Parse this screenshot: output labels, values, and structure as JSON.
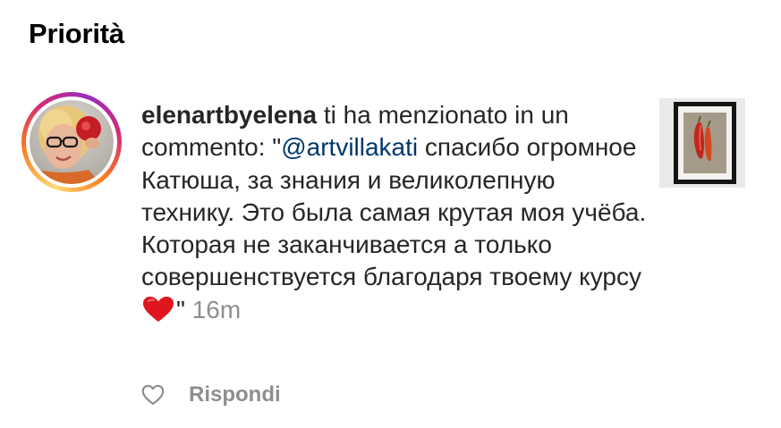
{
  "section": {
    "title": "Priorità"
  },
  "notification": {
    "username": "elenartbyelena",
    "action_text": " ti ha menzionato in un commento: \"",
    "mention": "@artvillakati",
    "comment_text": " спасибо огромное Катюша, за знания и великолепную технику. Это была самая крутая моя учёба. Которая не заканчивается а только совершенствуется благодаря твоему курсу",
    "emoji": "red-heart",
    "closing_quote": "\"",
    "timestamp": "16m",
    "avatar_icon": "user-avatar",
    "thumbnail_icon": "post-thumbnail-framed-peppers",
    "story_ring_colors": [
      "#feda75",
      "#fa7e1e",
      "#d62976",
      "#962fbf"
    ]
  },
  "actions": {
    "like_icon": "heart-outline-icon",
    "reply_label": "Rispondi"
  },
  "colors": {
    "text": "#262626",
    "mention": "#00376b",
    "muted": "#8e8e8e",
    "heart": "#e0161d"
  }
}
